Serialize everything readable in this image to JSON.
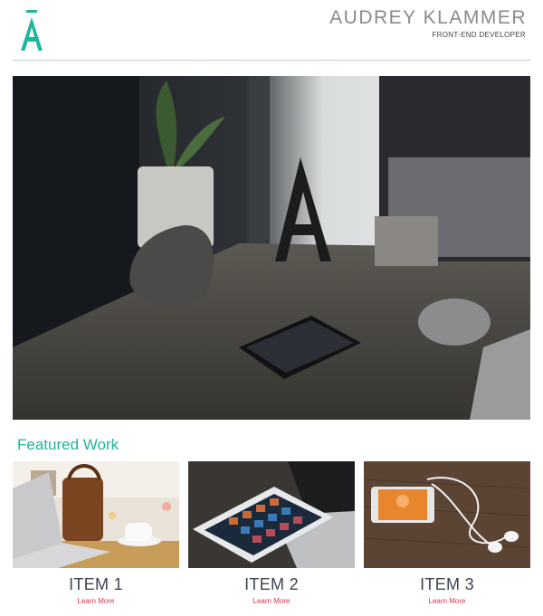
{
  "header": {
    "logo_icon": "letter-a-logo-icon",
    "name": "AUDREY KLAMMER",
    "subtitle": "FRONT-END DEVELOPER",
    "accent_color": "#1fb69a"
  },
  "hero": {
    "image_icon": "desk-workspace-photo"
  },
  "featured": {
    "title": "Featured Work",
    "items": [
      {
        "title": "ITEM 1",
        "link": "Learn More",
        "image_icon": "laptop-bag-coffee-photo"
      },
      {
        "title": "ITEM 2",
        "link": "Learn More",
        "image_icon": "tablet-laptop-photo"
      },
      {
        "title": "ITEM 3",
        "link": "Learn More",
        "image_icon": "phone-earbuds-photo"
      }
    ]
  },
  "colors": {
    "link": "#d4374f",
    "item_title": "#3c4350",
    "rule": "#c9c9c9"
  }
}
